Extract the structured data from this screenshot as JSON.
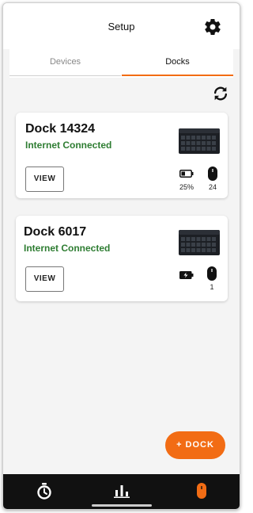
{
  "header": {
    "title": "Setup"
  },
  "tabs": [
    {
      "label": "Devices",
      "active": false
    },
    {
      "label": "Docks",
      "active": true
    }
  ],
  "docks": [
    {
      "name": "Dock 14324",
      "status": "Internet Connected",
      "view_label": "VIEW",
      "battery": "25%",
      "devices": "24"
    },
    {
      "name": "Dock 6017",
      "status": "Internet Connected",
      "view_label": "VIEW",
      "charging": true,
      "devices": "1"
    }
  ],
  "fab": {
    "label": "+ DOCK"
  },
  "colors": {
    "accent": "#f26c14",
    "connected": "#2e7d32",
    "tabbar": "#111111"
  },
  "icons": [
    "gear-icon",
    "refresh-icon",
    "battery-icon",
    "charging-icon",
    "mouse-icon",
    "stopwatch-icon",
    "bar-chart-icon",
    "device-icon"
  ]
}
